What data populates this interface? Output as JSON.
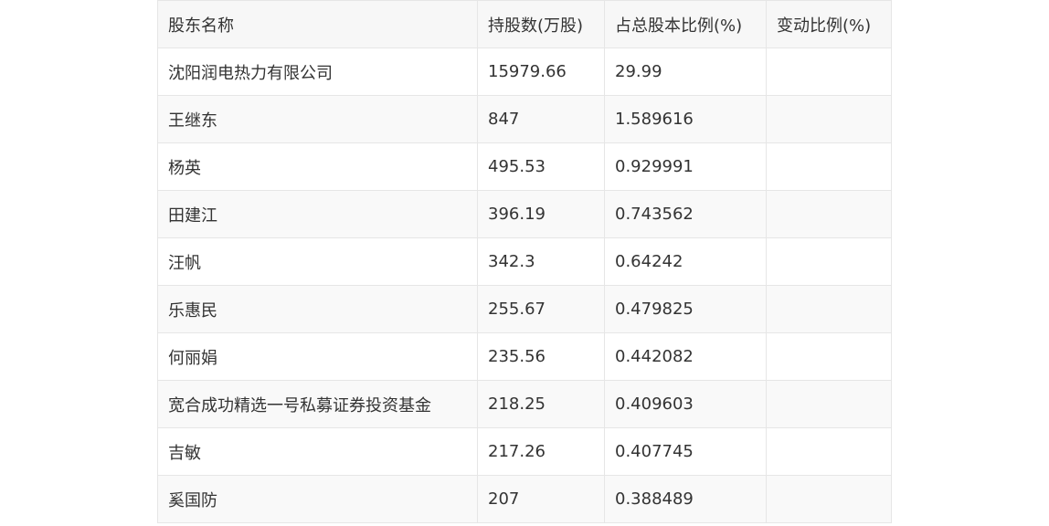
{
  "table": {
    "headers": [
      "股东名称",
      "持股数(万股)",
      "占总股本比例(%)",
      "变动比例(%)"
    ],
    "rows": [
      [
        "沈阳润电热力有限公司",
        "15979.66",
        "29.99",
        ""
      ],
      [
        "王继东",
        "847",
        "1.589616",
        ""
      ],
      [
        "杨英",
        "495.53",
        "0.929991",
        ""
      ],
      [
        "田建江",
        "396.19",
        "0.743562",
        ""
      ],
      [
        "汪帆",
        "342.3",
        "0.64242",
        ""
      ],
      [
        "乐惠民",
        "255.67",
        "0.479825",
        ""
      ],
      [
        "何丽娟",
        "235.56",
        "0.442082",
        ""
      ],
      [
        "宽合成功精选一号私募证券投资基金",
        "218.25",
        "0.409603",
        ""
      ],
      [
        "吉敏",
        "217.26",
        "0.407745",
        ""
      ],
      [
        "奚国防",
        "207",
        "0.388489",
        ""
      ]
    ]
  }
}
